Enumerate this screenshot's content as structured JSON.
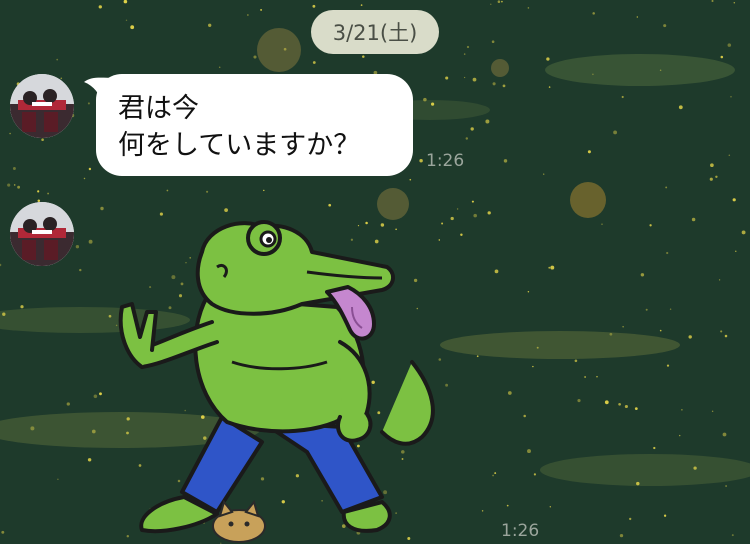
{
  "date_separator": {
    "label": "3/21(土)"
  },
  "messages": [
    {
      "type": "text",
      "lines": [
        "君は今",
        "何をしていますか？"
      ],
      "time": "1:26"
    },
    {
      "type": "sticker",
      "sticker_name": "frog-peace-sign-tongue-out",
      "time": "1:26"
    }
  ],
  "colors": {
    "background": "#1f3a2c",
    "bubble": "#ffffff",
    "date_pill": "#d9dcc9",
    "timestamp": "#9ba59c",
    "frog_green": "#7cc142",
    "pants_blue": "#2f55c8",
    "tongue_pink": "#c587cf"
  },
  "icons": {
    "avatar": "avatar-photo-icon",
    "kitty": "kitty-sticker-icon"
  }
}
